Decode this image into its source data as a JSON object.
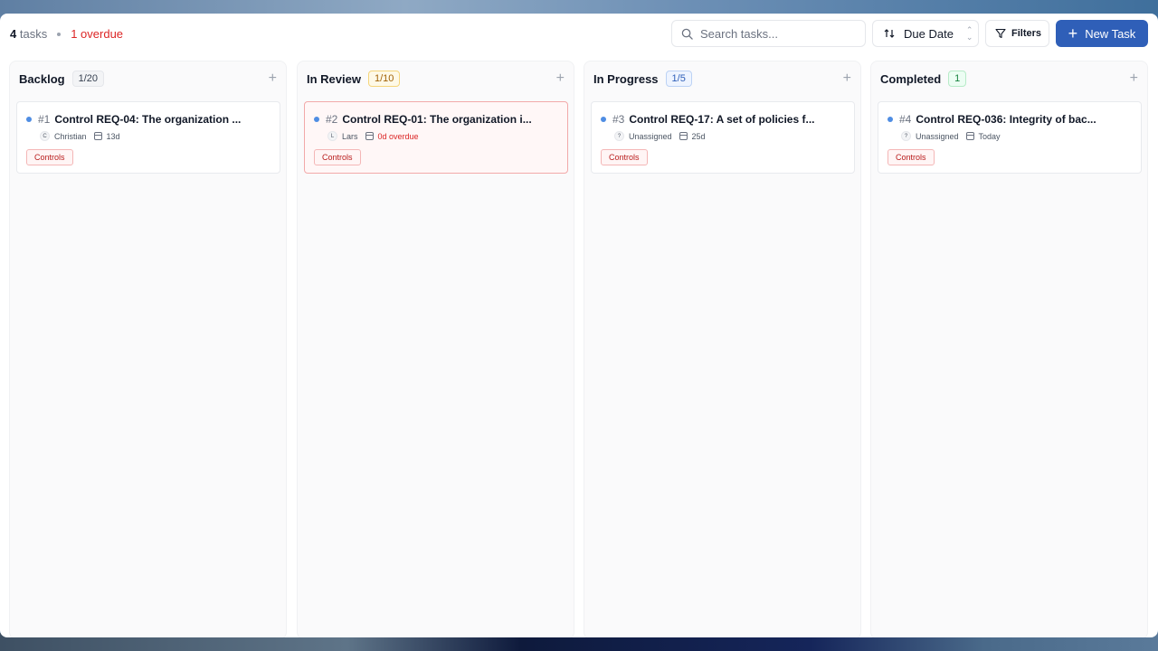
{
  "summary": {
    "task_count": "4",
    "tasks_word": "tasks",
    "overdue": "1 overdue"
  },
  "search": {
    "placeholder": "Search tasks..."
  },
  "sort": {
    "label": "Due Date"
  },
  "filters": {
    "label": "Filters"
  },
  "new_task": {
    "label": "New Task"
  },
  "colors": {
    "accent": "#2f5fb8",
    "overdue": "#dc2626",
    "priority_dot": "#4f8de3"
  },
  "columns": [
    {
      "title": "Backlog",
      "badge": "1/20",
      "card": {
        "number": "#1",
        "title": "Control REQ-04: The organization ...",
        "avatar": "C",
        "assignee": "Christian",
        "due": "13d",
        "tag": "Controls"
      }
    },
    {
      "title": "In Review",
      "badge": "1/10",
      "card": {
        "number": "#2",
        "title": "Control REQ-01: The organization i...",
        "avatar": "L",
        "assignee": "Lars",
        "due": "0d overdue",
        "tag": "Controls"
      }
    },
    {
      "title": "In Progress",
      "badge": "1/5",
      "card": {
        "number": "#3",
        "title": "Control REQ-17: A set of policies f...",
        "avatar": "?",
        "assignee": "Unassigned",
        "due": "25d",
        "tag": "Controls"
      }
    },
    {
      "title": "Completed",
      "badge": "1",
      "card": {
        "number": "#4",
        "title": "Control REQ-036: Integrity of bac...",
        "avatar": "?",
        "assignee": "Unassigned",
        "due": "Today",
        "tag": "Controls"
      }
    }
  ]
}
